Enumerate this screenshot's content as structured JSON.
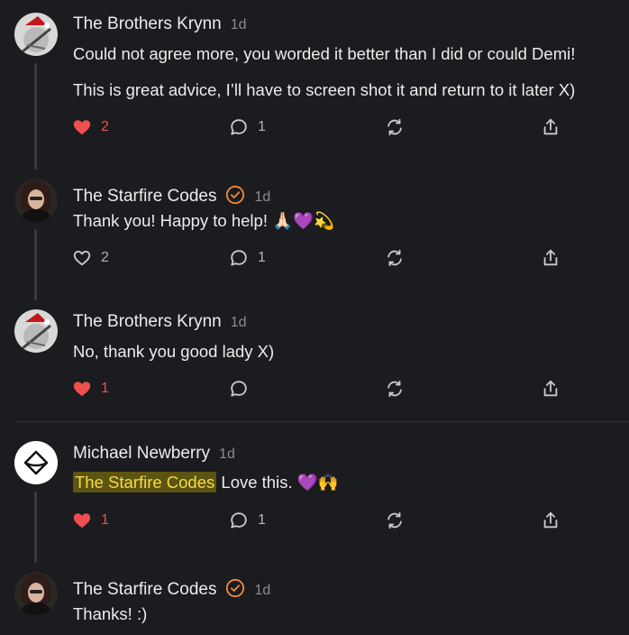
{
  "comments": [
    {
      "author": "The Brothers Krynn",
      "time": "1d",
      "verified": false,
      "lines": [
        "Could not agree more, you worded it better than I did or could Demi!",
        "This is great advice, I’ll have to screen shot it and return to it later X)"
      ],
      "likes": "2",
      "liked": true,
      "replies": "1"
    },
    {
      "author": "The Starfire Codes",
      "time": "1d",
      "verified": true,
      "text": "Thank you! Happy to help! 🙏🏻💜💫",
      "likes": "2",
      "liked": false,
      "replies": "1"
    },
    {
      "author": "The Brothers Krynn",
      "time": "1d",
      "verified": false,
      "text": "No, thank you good lady X)",
      "likes": "1",
      "liked": true,
      "replies": ""
    },
    {
      "author": "Michael Newberry",
      "time": "1d",
      "verified": false,
      "mention": "The Starfire Codes",
      "text": "Love this. 💜🙌",
      "likes": "1",
      "liked": true,
      "replies": "1"
    },
    {
      "author": "The Starfire Codes",
      "time": "1d",
      "verified": true,
      "text": "Thanks! :)"
    }
  ],
  "colors": {
    "background": "#1b1c1f",
    "like_active": "#ef4f4f",
    "verified_badge": "#f08a3c",
    "mention_bg": "#5c5410",
    "mention_text": "#f5dc4a"
  }
}
